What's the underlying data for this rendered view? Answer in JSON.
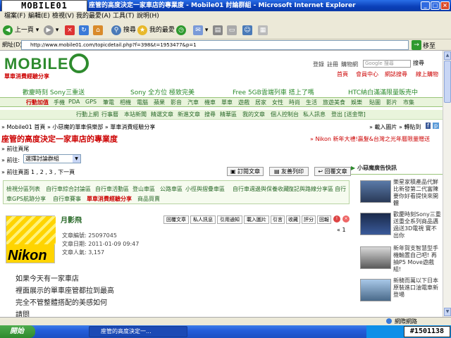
{
  "window": {
    "title": "座管的高度決定一家車店的專業度 - Mobile01 討論群組 - Microsoft Internet Explorer",
    "overlay_logo": "MOBILE01"
  },
  "menu": [
    "檔案(F)",
    "編輯(E)",
    "檢視(V)",
    "我的最愛(A)",
    "工具(T)",
    "說明(H)"
  ],
  "toolbar": {
    "back": "上一頁",
    "search": "搜尋",
    "favorites": "我的最愛"
  },
  "address": {
    "label": "網址(D)",
    "url": "http://www.mobile01.com/topicdetail.php?f=398&t=1953477&p=1",
    "go": "移至"
  },
  "page": {
    "logo": "MOBILE",
    "tagline": "單車消費經驗分享",
    "top_links": [
      "登錄",
      "註冊",
      "購物網"
    ],
    "search_placeholder": "Google 搜尋",
    "search_btn": "搜尋",
    "nav_right": [
      "首頁",
      "會員中心",
      "網誌搜尋",
      "線上購物"
    ],
    "promos": [
      "歡慶時刻 Sony三重送",
      "Sony 全方位 極致完美",
      "Free 5GB雲端列車 搭上了嗎",
      "HTC納白滿滿限量販売中"
    ],
    "nav_green": [
      "行動加值",
      "手機",
      "PDA",
      "GPS",
      "筆電",
      "相機",
      "電腦",
      "蘋果",
      "影音",
      "汽車",
      "機車",
      "單車",
      "遊戲",
      "居家",
      "女性",
      "時尚",
      "生活",
      "旅遊美食",
      "娛樂",
      "貼圖",
      "影片",
      "市集"
    ],
    "nav_sub": [
      "行動上網",
      "行事曆",
      "本站新聞",
      "精選文章",
      "新進文章",
      "搜尋",
      "精華區",
      "我的文章",
      "個人控制台",
      "私人訊息",
      "登出 [送金幣]"
    ],
    "breadcrumb": "» Mobile01 首頁 » 小惡魔的單車俱樂部 » 單車消費經驗分享",
    "right_login": "» 載入圖片 » 轉貼到",
    "topic_title": "座管的高度決定一家車店的專業度",
    "ad_line": "» Nikon 新年大禮!贏髮&台灣之光年曆限量贈送",
    "goto_end": "» 前往頁尾",
    "goto_label": "» 前往:",
    "goto_select": "選擇討論群組",
    "pages": "» 前往頁面 1 , 2 , 3 , 下一頁",
    "action_buttons": [
      "訂閱文章",
      "友善列印",
      "回覆文章"
    ],
    "category_row1": [
      "檢視分區列表",
      "自行車綜合討論區",
      "自行車活動區",
      "登山車區",
      "公路車區",
      "小徑與摺疊車區",
      "自行車週邊與保養收藏",
      "復記與路線分享區",
      "自行"
    ],
    "category_row2": [
      "車GPS航跡分享",
      "自行車賽事",
      "單車消費經驗分享",
      "商品買賣"
    ],
    "author": "月影飛",
    "post_buttons": [
      "回覆文章",
      "私人訊息",
      "引用通知",
      "載入圖片",
      "引言",
      "收藏",
      "評分",
      "回報"
    ],
    "pager": "«  1",
    "post_meta": [
      "文章編號: 25097045",
      "文章日期: 2011-01-09 09:47",
      "文章人氣: 3,157"
    ],
    "sponsor": "Nikon",
    "side_title": "小惡魔廣告快訊",
    "side_items": [
      "樂星家積產品代鮮比新發第二代富陳要你好看提快來開體",
      "歡慶時刻Sony三重送重全系列商品邁過送3D電視 實不出你",
      "新年賀支智慧型手機輸置自己吧! 再抽P5 Move遊戲組!",
      "新騎而萬以下日本原裝進口油電車新登場"
    ],
    "post_body": [
      "如果今天有一家車店",
      "裡面展示的單車座管都拉到最高",
      "完全不管整體搭配的美感如何",
      "請問"
    ]
  },
  "status": "網際網路",
  "taskbar": {
    "start": "開始",
    "task": "座管的高度決定一...",
    "watermark": "#1501138"
  }
}
